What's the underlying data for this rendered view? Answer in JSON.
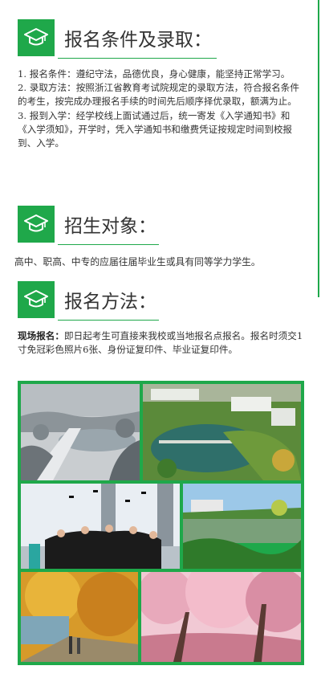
{
  "colors": {
    "accent": "#1fa84a",
    "text": "#333333"
  },
  "sections": [
    {
      "icon": "graduation-cap-icon",
      "title": "报名条件及录取：",
      "items": [
        "1. 报名条件：遵纪守法，品德优良，身心健康，能坚持正常学习。",
        "2. 录取方法：按照浙江省教育考试院规定的录取方法，符合报名条件的考生，按完成办理报名手续的时间先后顺序择优录取，额满为止。",
        "3. 报到入学：经学校线上面试通过后，统一寄发《入学通知书》和《入学须知》，开学时，凭入学通知书和缴费凭证按规定时间到校报到、入学。"
      ]
    },
    {
      "icon": "graduation-cap-icon",
      "title": "招生对象：",
      "text": "高中、职高、中专的应届往届毕业生或具有同等学力学生。"
    },
    {
      "icon": "graduation-cap-icon",
      "title": "报名方法：",
      "lead": "现场报名：",
      "text": "即日起考生可直接来我校或当地报名点报名。报名时须交1寸免冠彩色照片6张、身份证复印件、毕业证复印件。"
    }
  ]
}
